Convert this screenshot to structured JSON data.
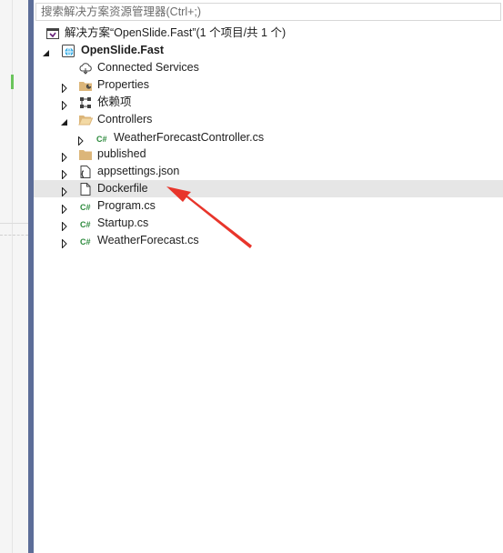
{
  "search": {
    "placeholder": "搜索解决方案资源管理器(Ctrl+;)"
  },
  "tree": {
    "solution": "解决方案“OpenSlide.Fast”(1 个项目/共 1 个)",
    "project": "OpenSlide.Fast",
    "items": [
      {
        "label": "Connected Services"
      },
      {
        "label": "Properties"
      },
      {
        "label": "依赖项"
      },
      {
        "label": "Controllers"
      },
      {
        "label": "WeatherForecastController.cs"
      },
      {
        "label": "published"
      },
      {
        "label": "appsettings.json"
      },
      {
        "label": "Dockerfile"
      },
      {
        "label": "Program.cs"
      },
      {
        "label": "Startup.cs"
      },
      {
        "label": "WeatherForecast.cs"
      }
    ],
    "cs_badge": "C#"
  },
  "colors": {
    "splitter": "#5c6d98",
    "hover_row": "#e6e6e6",
    "csharp_icon": "#2c8a3c",
    "folder": "#dcb67a",
    "annotation_arrow": "#e8352b"
  }
}
